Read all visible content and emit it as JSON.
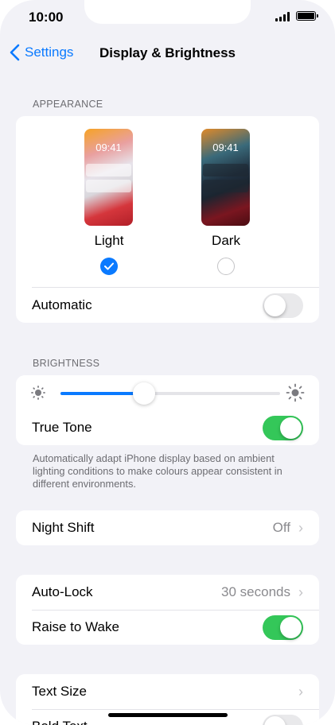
{
  "status_bar": {
    "time": "10:00"
  },
  "nav": {
    "back_label": "Settings",
    "title": "Display & Brightness"
  },
  "appearance": {
    "header": "APPEARANCE",
    "options": [
      {
        "label": "Light",
        "preview_time": "09:41",
        "selected": true
      },
      {
        "label": "Dark",
        "preview_time": "09:41",
        "selected": false
      }
    ],
    "automatic": {
      "label": "Automatic",
      "on": false
    }
  },
  "brightness": {
    "header": "BRIGHTNESS",
    "level": 0.38,
    "true_tone": {
      "label": "True Tone",
      "on": true
    },
    "footer": "Automatically adapt iPhone display based on ambient lighting conditions to make colours appear consistent in different environments."
  },
  "night_shift": {
    "label": "Night Shift",
    "value": "Off"
  },
  "lock": {
    "auto_lock": {
      "label": "Auto-Lock",
      "value": "30 seconds"
    },
    "raise_to_wake": {
      "label": "Raise to Wake",
      "on": true
    }
  },
  "text": {
    "text_size": {
      "label": "Text Size"
    },
    "bold_text": {
      "label": "Bold Text",
      "on": false
    }
  },
  "colors": {
    "accent": "#0a7aff",
    "toggle_on": "#34c759",
    "background": "#f2f2f7"
  },
  "icons": [
    "back-chevron-icon",
    "brightness-low-icon",
    "brightness-high-icon",
    "checkmark-icon",
    "chevron-right-icon",
    "signal-icon",
    "battery-icon"
  ]
}
